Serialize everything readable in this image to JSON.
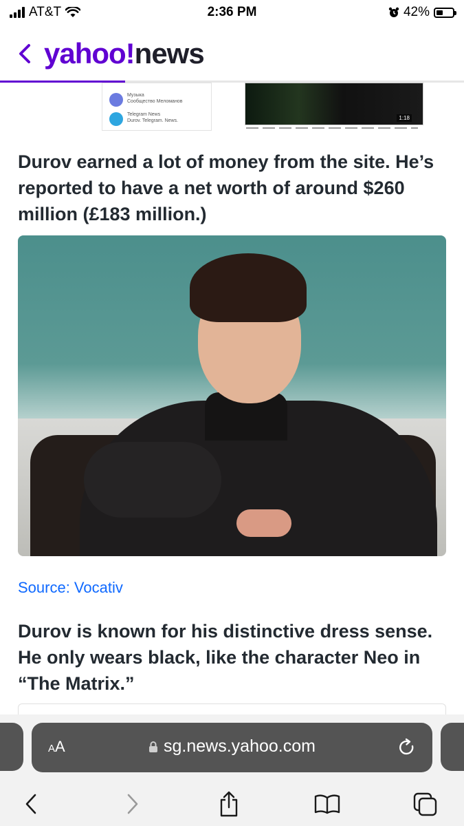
{
  "status_bar": {
    "carrier": "AT&T",
    "time": "2:36 PM",
    "battery_percent": "42%",
    "battery_level": 0.42
  },
  "header": {
    "logo_yahoo": "yahoo!",
    "logo_news": "news",
    "reading_progress": 0.27,
    "accent_color": "#6001d2"
  },
  "embed": {
    "row1_title": "Музыка",
    "row1_sub": "Сообщество Меломанов",
    "row2_title": "Telegram News",
    "row2_sub": "Durov. Telegram. News.",
    "video_time": "1:18"
  },
  "article": {
    "paragraph_1": "Durov earned a lot of money from the site. He’s reported to have a net worth of around $260 million (£183 million.)",
    "source": "Source: Vocativ",
    "paragraph_2": "Durov is known for his distinctive dress sense. He only wears black, like the character Neo in “The Matrix.”"
  },
  "browser": {
    "text_size_label_big": "A",
    "text_size_label_small": "A",
    "url": "sg.news.yahoo.com",
    "address_bar_color": "#545454",
    "link_color": "#0f69ff"
  },
  "toolbar": {
    "icons": [
      "back-icon",
      "forward-icon",
      "share-icon",
      "bookmarks-icon",
      "tabs-icon"
    ]
  }
}
